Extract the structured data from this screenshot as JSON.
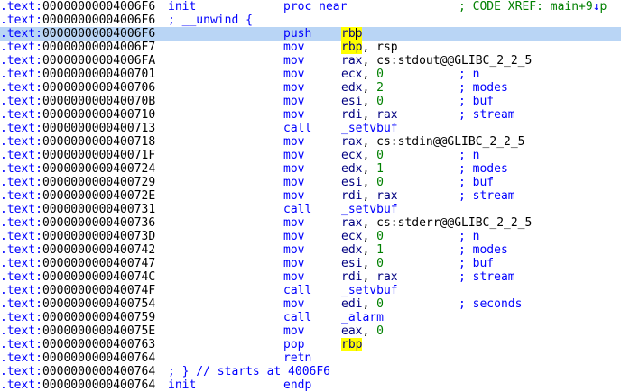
{
  "listing": {
    "lines": [
      {
        "seg": ".text:",
        "off": "00000000004006F6",
        "label": "init",
        "mn": "proc near",
        "ops": "",
        "comment": "; CODE XREF: main+9",
        "xref_arrow": "↓",
        "xref_tail": "p",
        "kind": "proc"
      },
      {
        "seg": ".text:",
        "off": "00000000004006F6",
        "inline": "; __unwind {",
        "kind": "inline"
      },
      {
        "seg": ".text:",
        "off": "00000000004006F6",
        "mn": "push",
        "ops_hl": "rbp",
        "cursor": true,
        "kind": "insn",
        "current": true
      },
      {
        "seg": ".text:",
        "off": "00000000004006F7",
        "mn": "mov",
        "ops_hl": "rbp",
        "ops_rest": ", rsp",
        "kind": "insn"
      },
      {
        "seg": ".text:",
        "off": "00000000004006FA",
        "mn": "mov",
        "reg": "rax",
        "ops_rest": ", cs:stdout@@GLIBC_2_2_5",
        "kind": "insn"
      },
      {
        "seg": ".text:",
        "off": "0000000000400701",
        "mn": "mov",
        "reg": "ecx",
        "num": "0",
        "comment": "; n",
        "kind": "insn"
      },
      {
        "seg": ".text:",
        "off": "0000000000400706",
        "mn": "mov",
        "reg": "edx",
        "num": "2",
        "comment": "; modes",
        "kind": "insn"
      },
      {
        "seg": ".text:",
        "off": "000000000040070B",
        "mn": "mov",
        "reg": "esi",
        "num": "0",
        "comment": "; buf",
        "kind": "insn"
      },
      {
        "seg": ".text:",
        "off": "0000000000400710",
        "mn": "mov",
        "reg": "rdi",
        "reg2": "rax",
        "comment": "; stream",
        "kind": "insn"
      },
      {
        "seg": ".text:",
        "off": "0000000000400713",
        "mn": "call",
        "name": "_setvbuf",
        "kind": "insn"
      },
      {
        "seg": ".text:",
        "off": "0000000000400718",
        "mn": "mov",
        "reg": "rax",
        "ops_rest": ", cs:stdin@@GLIBC_2_2_5",
        "kind": "insn"
      },
      {
        "seg": ".text:",
        "off": "000000000040071F",
        "mn": "mov",
        "reg": "ecx",
        "num": "0",
        "comment": "; n",
        "kind": "insn"
      },
      {
        "seg": ".text:",
        "off": "0000000000400724",
        "mn": "mov",
        "reg": "edx",
        "num": "1",
        "comment": "; modes",
        "kind": "insn"
      },
      {
        "seg": ".text:",
        "off": "0000000000400729",
        "mn": "mov",
        "reg": "esi",
        "num": "0",
        "comment": "; buf",
        "kind": "insn"
      },
      {
        "seg": ".text:",
        "off": "000000000040072E",
        "mn": "mov",
        "reg": "rdi",
        "reg2": "rax",
        "comment": "; stream",
        "kind": "insn"
      },
      {
        "seg": ".text:",
        "off": "0000000000400731",
        "mn": "call",
        "name": "_setvbuf",
        "kind": "insn"
      },
      {
        "seg": ".text:",
        "off": "0000000000400736",
        "mn": "mov",
        "reg": "rax",
        "ops_rest": ", cs:stderr@@GLIBC_2_2_5",
        "kind": "insn"
      },
      {
        "seg": ".text:",
        "off": "000000000040073D",
        "mn": "mov",
        "reg": "ecx",
        "num": "0",
        "comment": "; n",
        "kind": "insn"
      },
      {
        "seg": ".text:",
        "off": "0000000000400742",
        "mn": "mov",
        "reg": "edx",
        "num": "1",
        "comment": "; modes",
        "kind": "insn"
      },
      {
        "seg": ".text:",
        "off": "0000000000400747",
        "mn": "mov",
        "reg": "esi",
        "num": "0",
        "comment": "; buf",
        "kind": "insn"
      },
      {
        "seg": ".text:",
        "off": "000000000040074C",
        "mn": "mov",
        "reg": "rdi",
        "reg2": "rax",
        "comment": "; stream",
        "kind": "insn"
      },
      {
        "seg": ".text:",
        "off": "000000000040074F",
        "mn": "call",
        "name": "_setvbuf",
        "kind": "insn"
      },
      {
        "seg": ".text:",
        "off": "0000000000400754",
        "mn": "mov",
        "reg": "edi",
        "num": "0",
        "comment": "; seconds",
        "kind": "insn"
      },
      {
        "seg": ".text:",
        "off": "0000000000400759",
        "mn": "call",
        "name": "_alarm",
        "kind": "insn"
      },
      {
        "seg": ".text:",
        "off": "000000000040075E",
        "mn": "mov",
        "reg": "eax",
        "num": "0",
        "kind": "insn"
      },
      {
        "seg": ".text:",
        "off": "0000000000400763",
        "mn": "pop",
        "ops_hl": "rbp",
        "kind": "insn"
      },
      {
        "seg": ".text:",
        "off": "0000000000400764",
        "mn": "retn",
        "kind": "insn"
      },
      {
        "seg": ".text:",
        "off": "0000000000400764",
        "inline": "; } // starts at 4006F6",
        "kind": "inline"
      },
      {
        "seg": ".text:",
        "off": "0000000000400764",
        "label": "init",
        "mn": "endp",
        "kind": "endp"
      }
    ]
  },
  "colors": {
    "current_line": "#b9d5f5",
    "highlight": "#ffff00",
    "segment": "#0000ff",
    "register": "#000080",
    "number": "#008000",
    "comment": "#0000ff",
    "xref": "#008000"
  }
}
